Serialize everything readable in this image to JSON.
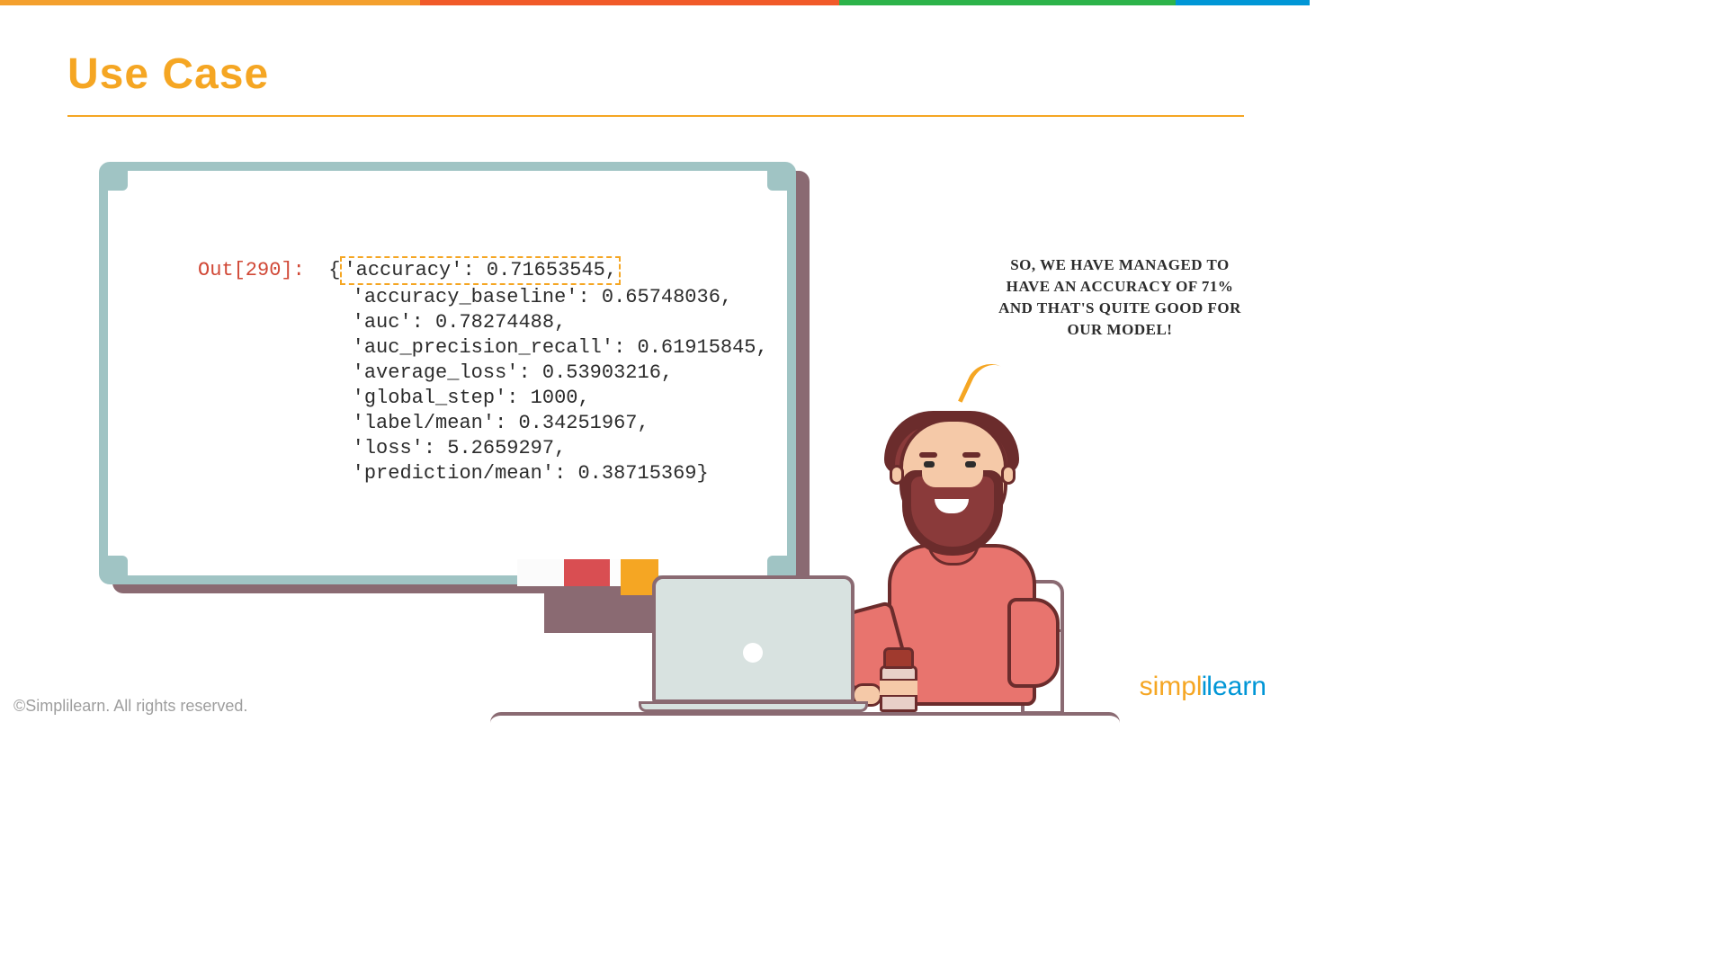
{
  "title": "Use Case",
  "code": {
    "out_label": "Out[290]:",
    "highlight": "'accuracy': 0.71653545,",
    "lines": [
      " 'accuracy_baseline': 0.65748036,",
      " 'auc': 0.78274488,",
      " 'auc_precision_recall': 0.61915845,",
      " 'average_loss': 0.53903216,",
      " 'global_step': 1000,",
      " 'label/mean': 0.34251967,",
      " 'loss': 5.2659297,",
      " 'prediction/mean': 0.38715369}"
    ]
  },
  "speech": "SO, WE HAVE MANAGED TO HAVE AN ACCURACY OF 71% AND THAT'S QUITE GOOD FOR OUR MODEL!",
  "copyright": "©Simplilearn. All rights reserved.",
  "logo": {
    "part1": "simpl",
    "sep": "i",
    "part2": "learn"
  }
}
